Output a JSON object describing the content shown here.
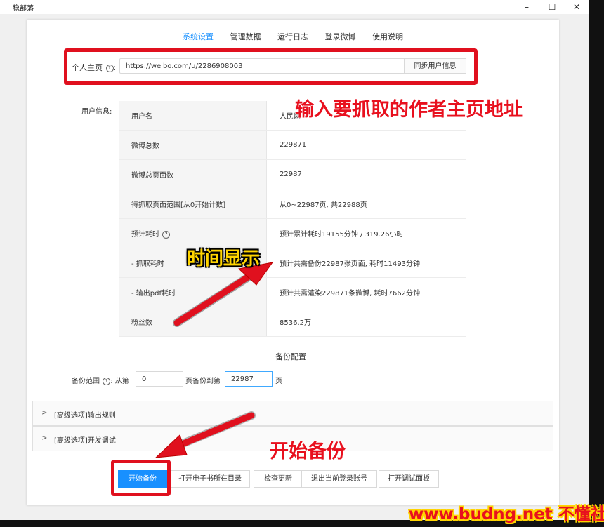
{
  "window": {
    "title": "稳部落",
    "min": "–",
    "max": "☐",
    "close": "✕"
  },
  "tabs": [
    {
      "label": "系统设置",
      "active": true
    },
    {
      "label": "管理数据",
      "active": false
    },
    {
      "label": "运行日志",
      "active": false
    },
    {
      "label": "登录微博",
      "active": false
    },
    {
      "label": "使用说明",
      "active": false
    }
  ],
  "homepage": {
    "label": "个人主页",
    "help": "?",
    "colon": ":",
    "value": "https://weibo.com/u/2286908003",
    "sync_button": "同步用户信息"
  },
  "user_info": {
    "label": "用户信息:",
    "rows": [
      {
        "key": "用户名",
        "value": "人民网"
      },
      {
        "key": "微博总数",
        "value": "229871"
      },
      {
        "key": "微博总页面数",
        "value": "22987"
      },
      {
        "key": "待抓取页面范围[从0开始计数]",
        "value": "从0~22987页, 共22988页"
      },
      {
        "key": "预计耗时",
        "value": "预计累计耗时19155分钟 / 319.26小时"
      },
      {
        "key": "- 抓取耗时",
        "value": "预计共需备份22987张页面, 耗时11493分钟"
      },
      {
        "key": "- 输出pdf耗时",
        "value": "预计共需渲染229871条微博, 耗时7662分钟"
      },
      {
        "key": "粉丝数",
        "value": "8536.2万"
      }
    ]
  },
  "backup_config": {
    "section_title": "备份配置",
    "range_label": "备份范围",
    "help": "?",
    "from_label": ": 从第",
    "from_value": "0",
    "mid_label": "页备份到第",
    "to_value": "22987",
    "end_label": "页"
  },
  "collapses": [
    {
      "arrow": ">",
      "label": "[高级选项]输出规则"
    },
    {
      "arrow": ">",
      "label": "[高级选项]开发调试"
    }
  ],
  "buttons": {
    "start": "开始备份",
    "open_dir": "打开电子书所在目录",
    "check_update": "检查更新",
    "logout": "退出当前登录账号",
    "debug_panel": "打开调试面板"
  },
  "annotations": {
    "homepage_hint": "输入要抓取的作者主页地址",
    "time_hint": "时间显示",
    "start_hint": "开始备份",
    "watermark": "www.budng.net 不懂社区"
  },
  "colors": {
    "accent": "#1890ff",
    "annotation_red": "#e0101e",
    "annotation_yellow": "#ffd400"
  }
}
